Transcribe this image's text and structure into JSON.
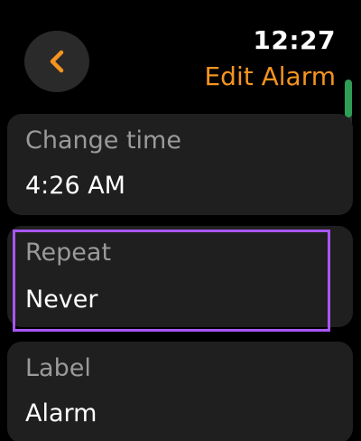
{
  "status_bar": {
    "time": "12:27"
  },
  "header": {
    "title": "Edit Alarm",
    "back_icon": "chevron-left-icon"
  },
  "colors": {
    "accent": "#f5941f",
    "background": "#000000",
    "card": "#1f1f1f",
    "highlight": "#a855f7",
    "scroll_thumb": "#2f9e55"
  },
  "scroll": {
    "position_fraction": 0.0
  },
  "items": [
    {
      "label": "Change time",
      "value": "4:26 AM"
    },
    {
      "label": "Repeat",
      "value": "Never"
    },
    {
      "label": "Label",
      "value": "Alarm"
    }
  ]
}
